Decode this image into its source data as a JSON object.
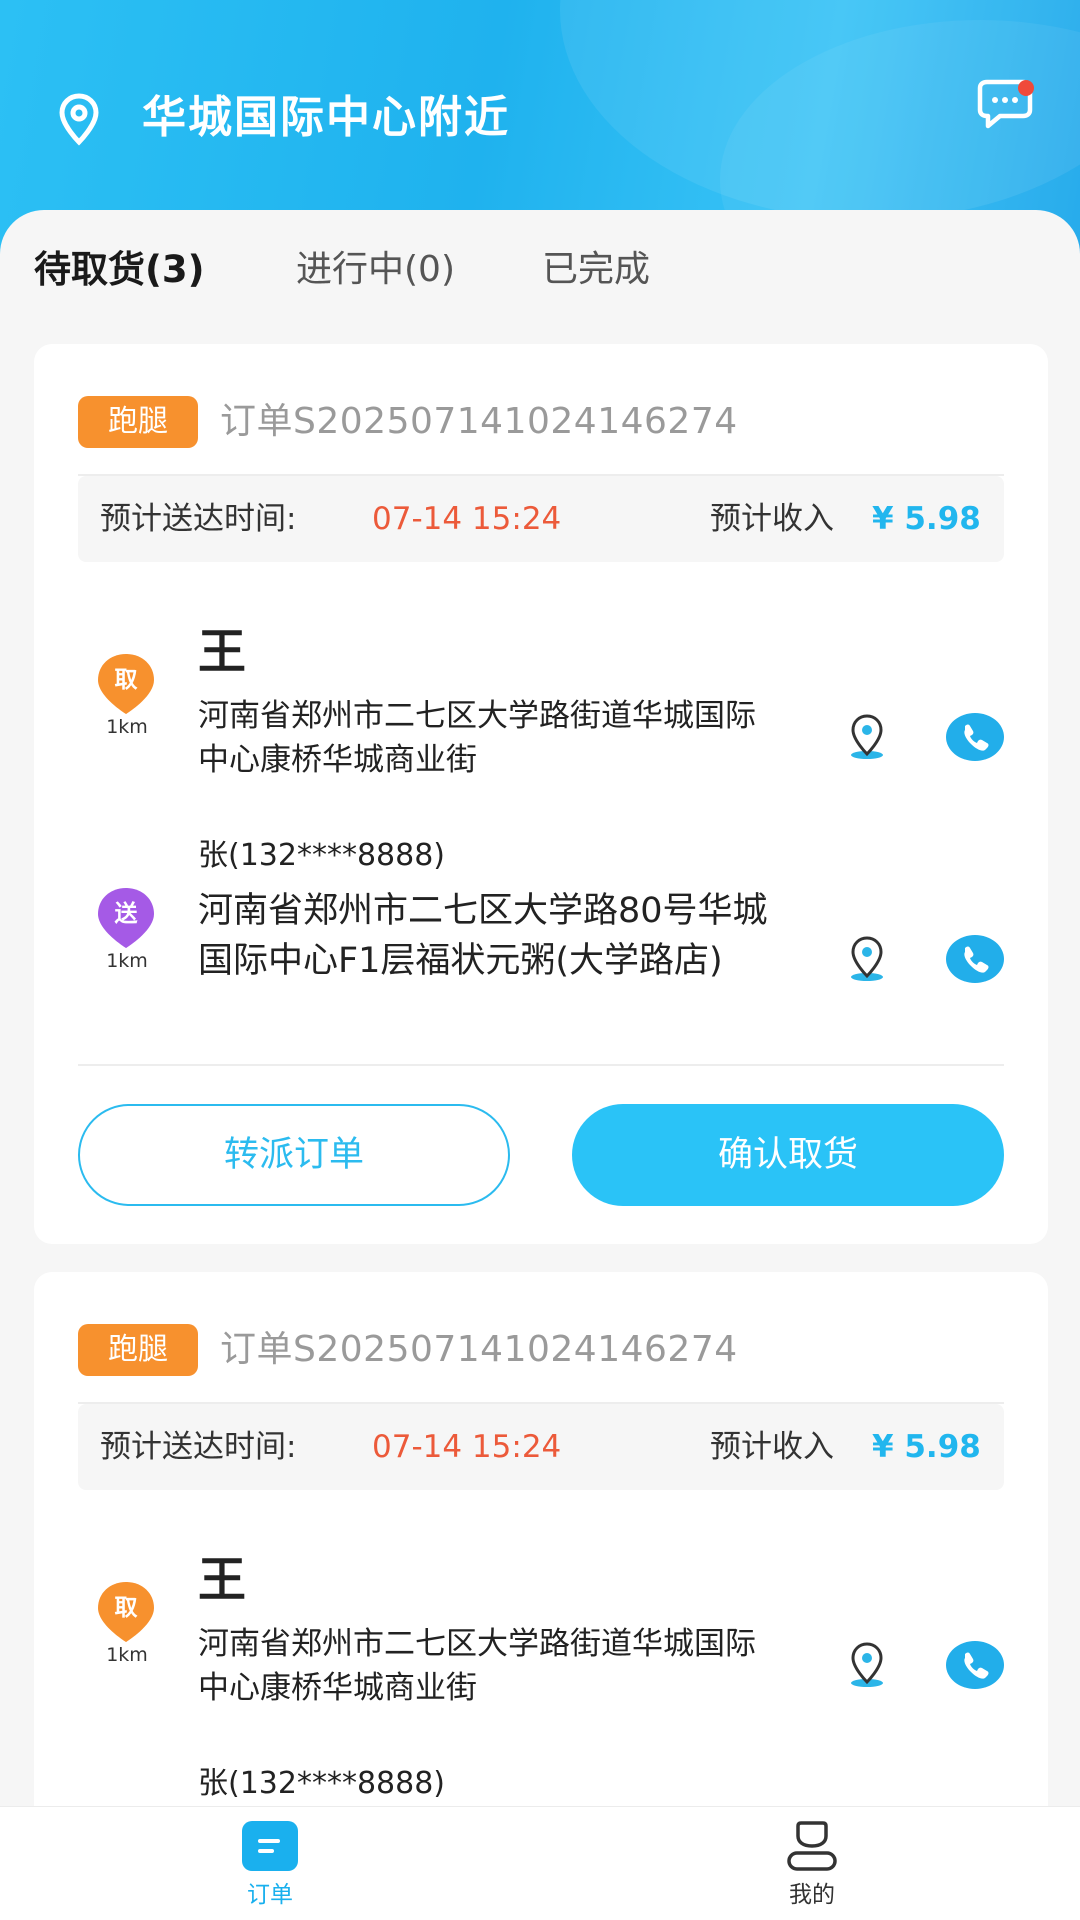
{
  "header": {
    "location_title": "华城国际中心附近",
    "accent_color": "#1fb2ee",
    "location_icon": "location-pin-icon",
    "message_icon": "chat-message-icon"
  },
  "tabs": [
    {
      "label": "待取货(3)",
      "active": true
    },
    {
      "label": "进行中(0)",
      "active": false
    },
    {
      "label": "已完成",
      "active": false
    }
  ],
  "orders": [
    {
      "badge": "跑腿",
      "order_no": "订单S2025071410241462​74",
      "eta_label": "预计送达时间:",
      "eta_time": "07-14 15:24",
      "income_label": "预计收入",
      "income_value": "¥ 5.98",
      "pickup": {
        "tag": "取",
        "distance": "1km",
        "name": "王",
        "address": "河南省郑州市二七区大学路街道华城国际中心康桥华城商业街"
      },
      "delivery": {
        "contact": "张(132****8888)",
        "tag": "送",
        "distance": "1km",
        "address": "河南省郑州市二七区大学路80号华城国际中心F1层福状元粥(大学路店)"
      },
      "btn_transfer": "转派订单",
      "btn_confirm": "确认取货"
    },
    {
      "badge": "跑腿",
      "order_no": "订单S2025071410241462​74",
      "eta_label": "预计送达时间:",
      "eta_time": "07-14 15:24",
      "income_label": "预计收入",
      "income_value": "¥ 5.98",
      "pickup": {
        "tag": "取",
        "distance": "1km",
        "name": "王",
        "address": "河南省郑州市二七区大学路街道华城国际中心康桥华城商业街"
      },
      "delivery": {
        "contact": "张(132****8888)"
      }
    }
  ],
  "bottom_nav": [
    {
      "label": "订单",
      "icon": "order-list-icon",
      "active": true
    },
    {
      "label": "我的",
      "icon": "profile-icon",
      "active": false
    }
  ]
}
